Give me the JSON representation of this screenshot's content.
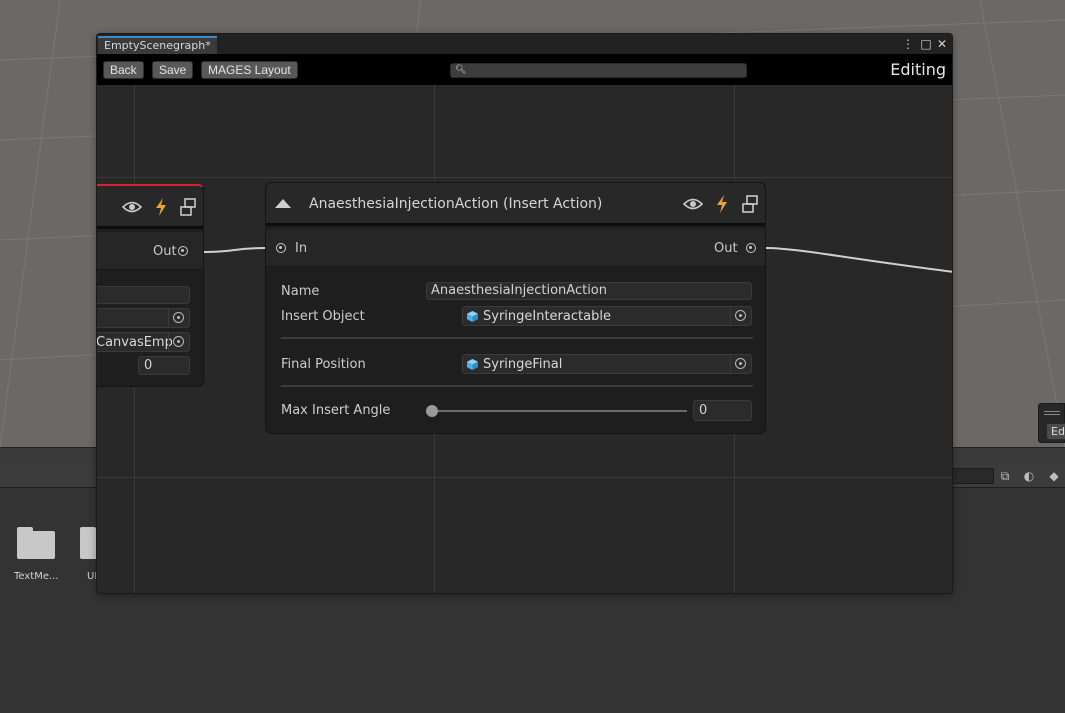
{
  "window": {
    "tab_title": "EmptyScenegraph*",
    "controls": {
      "menu": "⋮",
      "maximize": "□",
      "close": "✕"
    }
  },
  "toolbar": {
    "back_label": "Back",
    "save_label": "Save",
    "layout_label": "MAGES Layout",
    "search_placeholder": "",
    "mode_label": "Editing"
  },
  "left_node": {
    "out_label": "Out",
    "field_object_value": "CanvasEmp",
    "number_value": "0"
  },
  "main_node": {
    "title": "AnaesthesiaInjectionAction (Insert Action)",
    "in_label": "In",
    "out_label": "Out",
    "fields": {
      "name_label": "Name",
      "name_value": "AnaesthesiaInjectionAction",
      "insert_object_label": "Insert Object",
      "insert_object_value": "SyringeInteractable",
      "final_position_label": "Final Position",
      "final_position_value": "SyringeFinal",
      "max_insert_angle_label": "Max Insert Angle",
      "max_insert_angle_value": "0"
    },
    "max_insert_angle_slider": 0
  },
  "project": {
    "folders": [
      {
        "label": "TextMe..."
      },
      {
        "label": "UI"
      }
    ]
  },
  "right_fragment": {
    "button_label": "Ed"
  },
  "colors": {
    "accent_blue": "#3c8ac9",
    "error_red": "#d8232a",
    "icon_orange": "#e8a23a",
    "cube_blue": "#4fb3e8"
  },
  "icons": [
    "eye-icon",
    "lightning-icon",
    "link-icon",
    "collapse-triangle-icon",
    "cube-icon",
    "object-picker-icon",
    "search-icon",
    "folder-icon"
  ]
}
